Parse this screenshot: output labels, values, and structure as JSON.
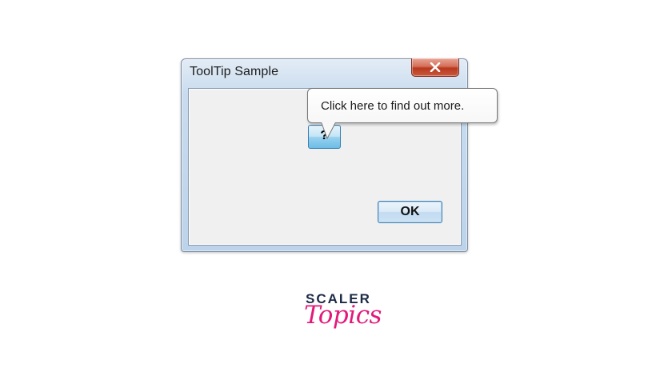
{
  "window": {
    "title": "ToolTip Sample",
    "close_icon": "close-x-icon"
  },
  "buttons": {
    "help_label": "?",
    "ok_label": "OK"
  },
  "tooltip": {
    "text": "Click here to find out more."
  },
  "logo": {
    "line1": "SCALER",
    "line2": "Topics",
    "colors": {
      "line1": "#1b2a45",
      "line2": "#e3197a"
    }
  },
  "colors": {
    "button_border": "#3c7fb1",
    "close_button": "#c9583b",
    "client_background": "#f0f0f0"
  }
}
